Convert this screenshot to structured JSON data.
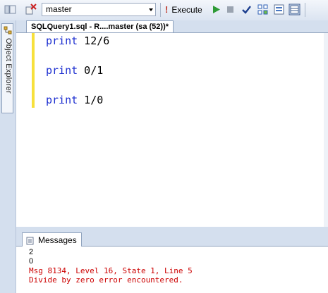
{
  "toolbar": {
    "database": "master",
    "execute_label": "Execute",
    "icons": [
      "toggle-panel-icon",
      "change-connection-icon",
      "execute-icon",
      "debug-run-icon",
      "stop-icon",
      "parse-check-icon",
      "query-options-icon",
      "results-to-text-icon",
      "results-to-grid-icon"
    ]
  },
  "left_panel": {
    "object_explorer_label": "Object Explorer"
  },
  "document": {
    "tab_title": "SQLQuery1.sql - R....master (sa (52))*",
    "lines": [
      {
        "keyword": "print",
        "expr": " 12/6"
      },
      {
        "keyword": "print",
        "expr": " 0/1"
      },
      {
        "keyword": "print",
        "expr": " 1/0"
      }
    ]
  },
  "results": {
    "tab_label": "Messages",
    "outputs": [
      "2",
      "0"
    ],
    "errors": [
      "Msg 8134, Level 16, State 1, Line 5",
      "Divide by zero error encountered."
    ]
  },
  "colors": {
    "keyword": "#1d2fd0",
    "error": "#cc0000",
    "change_marker": "#f7e03b"
  }
}
